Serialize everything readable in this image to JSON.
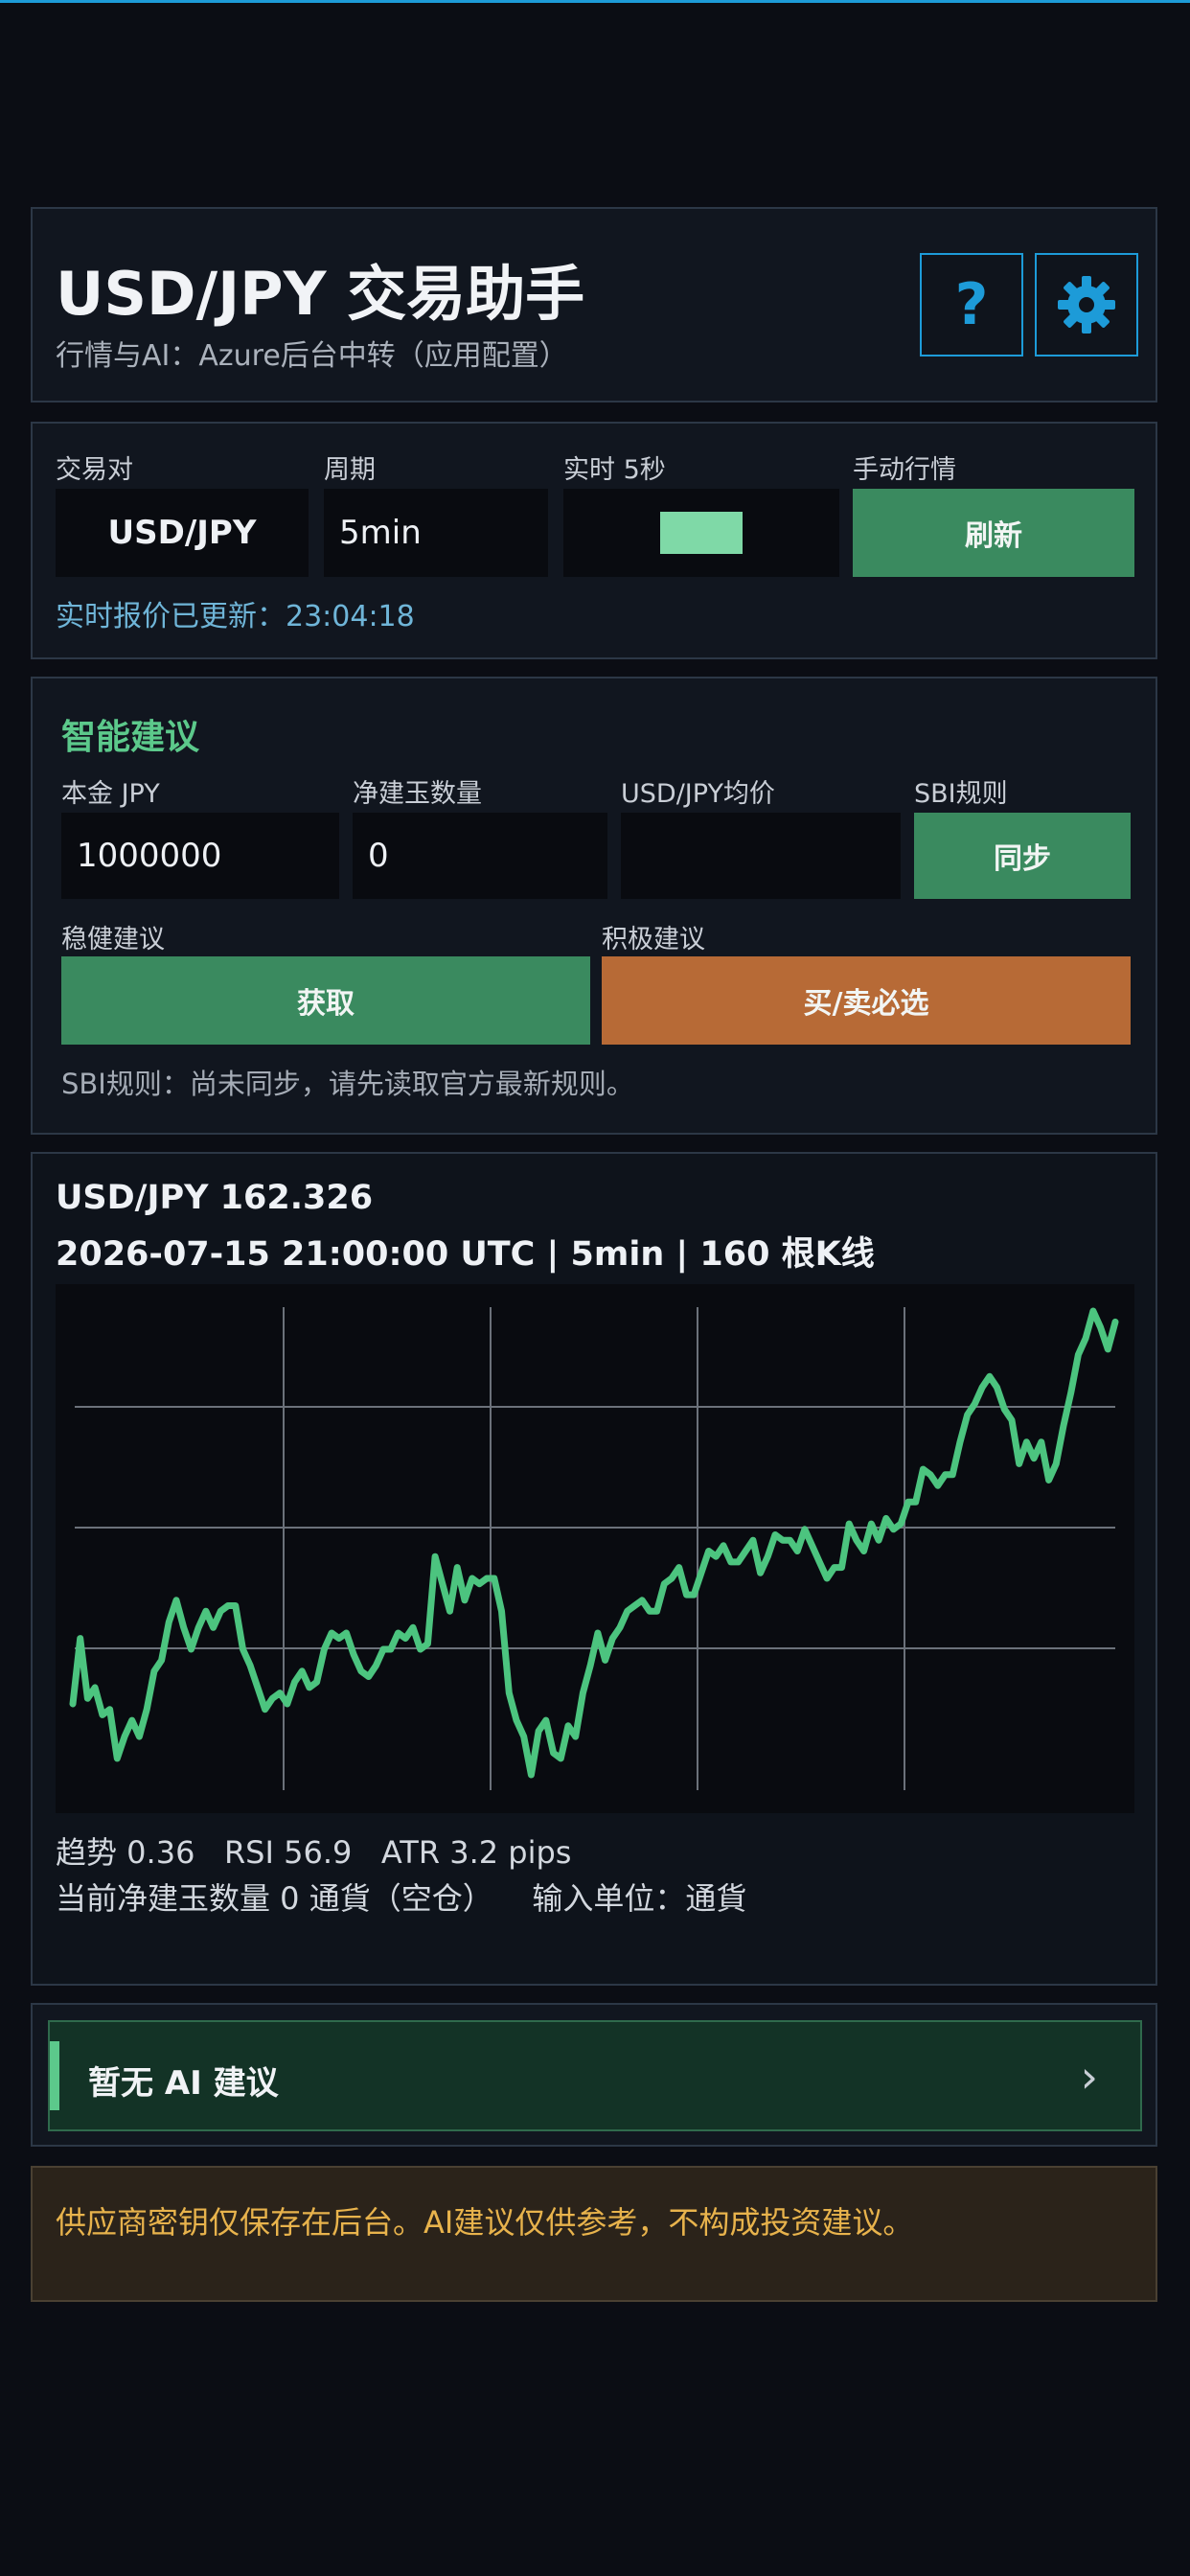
{
  "header": {
    "title": "USD/JPY 交易助手",
    "subtitle": "行情与AI：Azure后台中转（应用配置）",
    "help_icon": "question-icon",
    "settings_icon": "gear-icon"
  },
  "market": {
    "pair_label": "交易对",
    "pair_value": "USD/JPY",
    "period_label": "周期",
    "period_value": "5min",
    "realtime_label": "实时 5秒",
    "realtime_toggle_on": true,
    "manual_label": "手动行情",
    "refresh_button": "刷新",
    "status_text": "实时报价已更新：23:04:18"
  },
  "advice": {
    "section_title": "智能建议",
    "principal_label": "本金 JPY",
    "principal_value": "1000000",
    "position_label": "净建玉数量",
    "position_value": "0",
    "avg_price_label": "USD/JPY均价",
    "avg_price_value": "",
    "sbi_label": "SBI规则",
    "sync_button": "同步",
    "stable_label": "稳健建议",
    "get_button": "获取",
    "aggressive_label": "积极建议",
    "buy_sell_button": "买/卖必选",
    "sbi_status": "SBI规则：尚未同步，请先读取官方最新规则。"
  },
  "chart_card": {
    "price_line": "USD/JPY 162.326",
    "meta_line": "2026-07-15 21:00:00 UTC | 5min | 160 根K线",
    "indicators": "趋势 0.36   RSI 56.9   ATR 3.2 pips",
    "position_line": "当前净建玉数量 0 通貨（空仓）    输入单位：通貨"
  },
  "ai_banner": {
    "text": "暂无 AI 建议",
    "chevron": "›"
  },
  "notice": {
    "text": "供应商密钥仅保存在后台。AI建议仅供参考，不构成投资建议。"
  },
  "colors": {
    "accent_blue": "#1d9bd8",
    "green": "#3a8a5f",
    "orange": "#b76a36",
    "line": "#4cc47f",
    "notice_text": "#e8b34c"
  },
  "chart_data": {
    "type": "line",
    "title": "",
    "xlabel": "",
    "ylabel": "",
    "grid": true,
    "series": [
      {
        "values": [
          161.88,
          162.0,
          161.89,
          161.91,
          161.86,
          161.87,
          161.78,
          161.82,
          161.85,
          161.82,
          161.87,
          161.94,
          161.96,
          162.03,
          162.07,
          162.02,
          161.98,
          162.02,
          162.05,
          162.02,
          162.05,
          162.06,
          162.06,
          161.98,
          161.95,
          161.91,
          161.87,
          161.89,
          161.9,
          161.88,
          161.92,
          161.94,
          161.91,
          161.92,
          161.98,
          162.01,
          162.0,
          162.01,
          161.97,
          161.94,
          161.93,
          161.95,
          161.98,
          161.98,
          162.01,
          162.0,
          162.02,
          161.98,
          161.99,
          162.15,
          162.1,
          162.05,
          162.13,
          162.07,
          162.11,
          162.1,
          162.11,
          162.11,
          162.05,
          161.9,
          161.85,
          161.82,
          161.75,
          161.83,
          161.85,
          161.79,
          161.78,
          161.84,
          161.82,
          161.9,
          161.95,
          162.01,
          161.96,
          162.0,
          162.02,
          162.05,
          162.06,
          162.07,
          162.05,
          162.05,
          162.1,
          162.11,
          162.13,
          162.08,
          162.08,
          162.12,
          162.16,
          162.15,
          162.17,
          162.14,
          162.14,
          162.16,
          162.18,
          162.12,
          162.15,
          162.19,
          162.18,
          162.18,
          162.16,
          162.2,
          162.17,
          162.14,
          162.11,
          162.13,
          162.13,
          162.21,
          162.18,
          162.16,
          162.21,
          162.18,
          162.22,
          162.2,
          162.21,
          162.25,
          162.25,
          162.31,
          162.3,
          162.28,
          162.3,
          162.3,
          162.36,
          162.41,
          162.43,
          162.46,
          162.48,
          162.46,
          162.42,
          162.4,
          162.32,
          162.36,
          162.33,
          162.36,
          162.29,
          162.32,
          162.39,
          162.45,
          162.52,
          162.55,
          162.6,
          162.57,
          162.53,
          162.58
        ]
      }
    ]
  }
}
